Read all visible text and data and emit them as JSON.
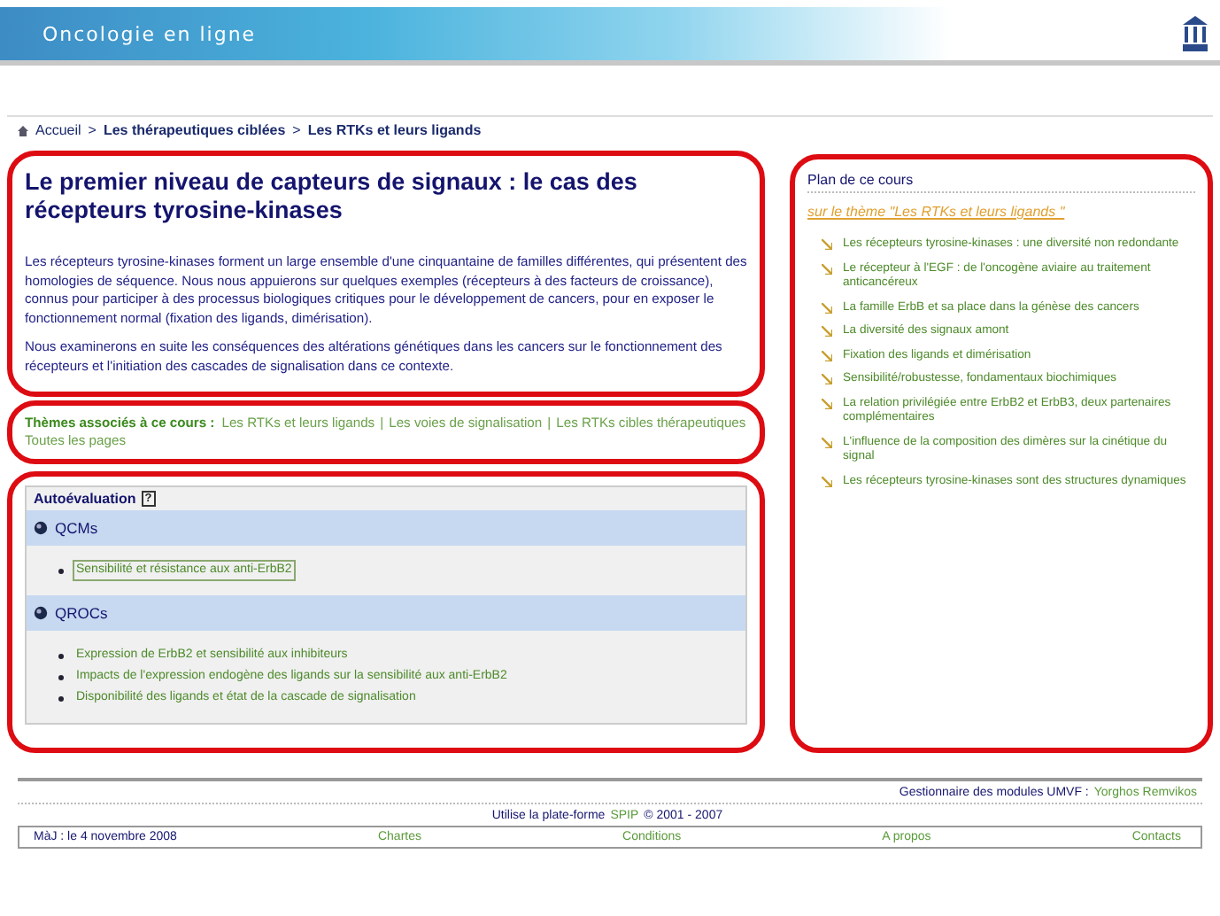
{
  "header": {
    "title": "Oncologie en ligne"
  },
  "breadcrumb": {
    "separator": ">",
    "items": [
      {
        "label": "Accueil"
      },
      {
        "label": "Les thérapeutiques ciblées"
      },
      {
        "label": "Les RTKs et leurs ligands"
      }
    ]
  },
  "article": {
    "title": "Le premier niveau de capteurs de signaux : le cas des récepteurs tyrosine-kinases",
    "paragraphs": [
      "Les récepteurs tyrosine-kinases forment un large ensemble d'une cinquantaine de familles différentes, qui présentent des homologies de séquence. Nous nous appuierons sur quelques exemples (récepteurs à des facteurs de croissance), connus pour participer à des processus biologiques critiques pour le développement de cancers, pour en exposer le fonctionnement normal (fixation des ligands, dimérisation).",
      "Nous examinerons en suite les conséquences des altérations génétiques dans les cancers sur le fonctionnement des récepteurs et l'initiation des cascades de signalisation dans ce contexte."
    ]
  },
  "themes": {
    "label": "Thèmes associés à ce cours :",
    "separator": "|",
    "links": [
      "Les RTKs et leurs ligands",
      "Les voies de signalisation",
      "Les RTKs cibles thérapeutiques"
    ],
    "more": "Toutes les pages"
  },
  "self_assessment": {
    "title": "Autoévaluation",
    "help": "?",
    "sections": [
      {
        "title": "QCMs",
        "items": [
          {
            "label": "Sensibilité et résistance aux anti-ErbB2",
            "selected": true
          }
        ]
      },
      {
        "title": "QROCs",
        "items": [
          {
            "label": "Expression de ErbB2 et sensibilité aux inhibiteurs",
            "selected": false
          },
          {
            "label": "Impacts de l'expression endogène des ligands sur la sensibilité aux anti-ErbB2",
            "selected": false
          },
          {
            "label": "Disponibilité des ligands et état de la cascade de signalisation",
            "selected": false
          }
        ]
      }
    ]
  },
  "plan": {
    "title": "Plan de ce cours",
    "theme": "sur le thème \"Les RTKs et leurs ligands \"",
    "items": [
      "Les récepteurs tyrosine-kinases : une diversité non redondante",
      "Le récepteur à l'EGF : de l'oncogène aviaire au traitement anticancéreux",
      "La famille ErbB et sa place dans la génèse des cancers",
      "La diversité des signaux amont",
      "Fixation des ligands et dimérisation",
      "Sensibilité/robustesse, fondamentaux biochimiques",
      "La relation privilégiée entre ErbB2 et ErbB3, deux partenaires complémentaires",
      "L'influence de la composition des dimères sur la cinétique du signal",
      "Les récepteurs tyrosine-kinases sont des structures dynamiques"
    ]
  },
  "footer": {
    "manager_label": "Gestionnaire des modules UMVF :",
    "manager": "Yorghos Remvikos",
    "platform_prefix": "Utilise la plate-forme",
    "platform": "SPIP",
    "platform_suffix": "© 2001 - 2007",
    "updated": "MàJ : le 4 novembre 2008",
    "links": [
      "Chartes",
      "Conditions",
      "A propos",
      "Contacts"
    ]
  }
}
